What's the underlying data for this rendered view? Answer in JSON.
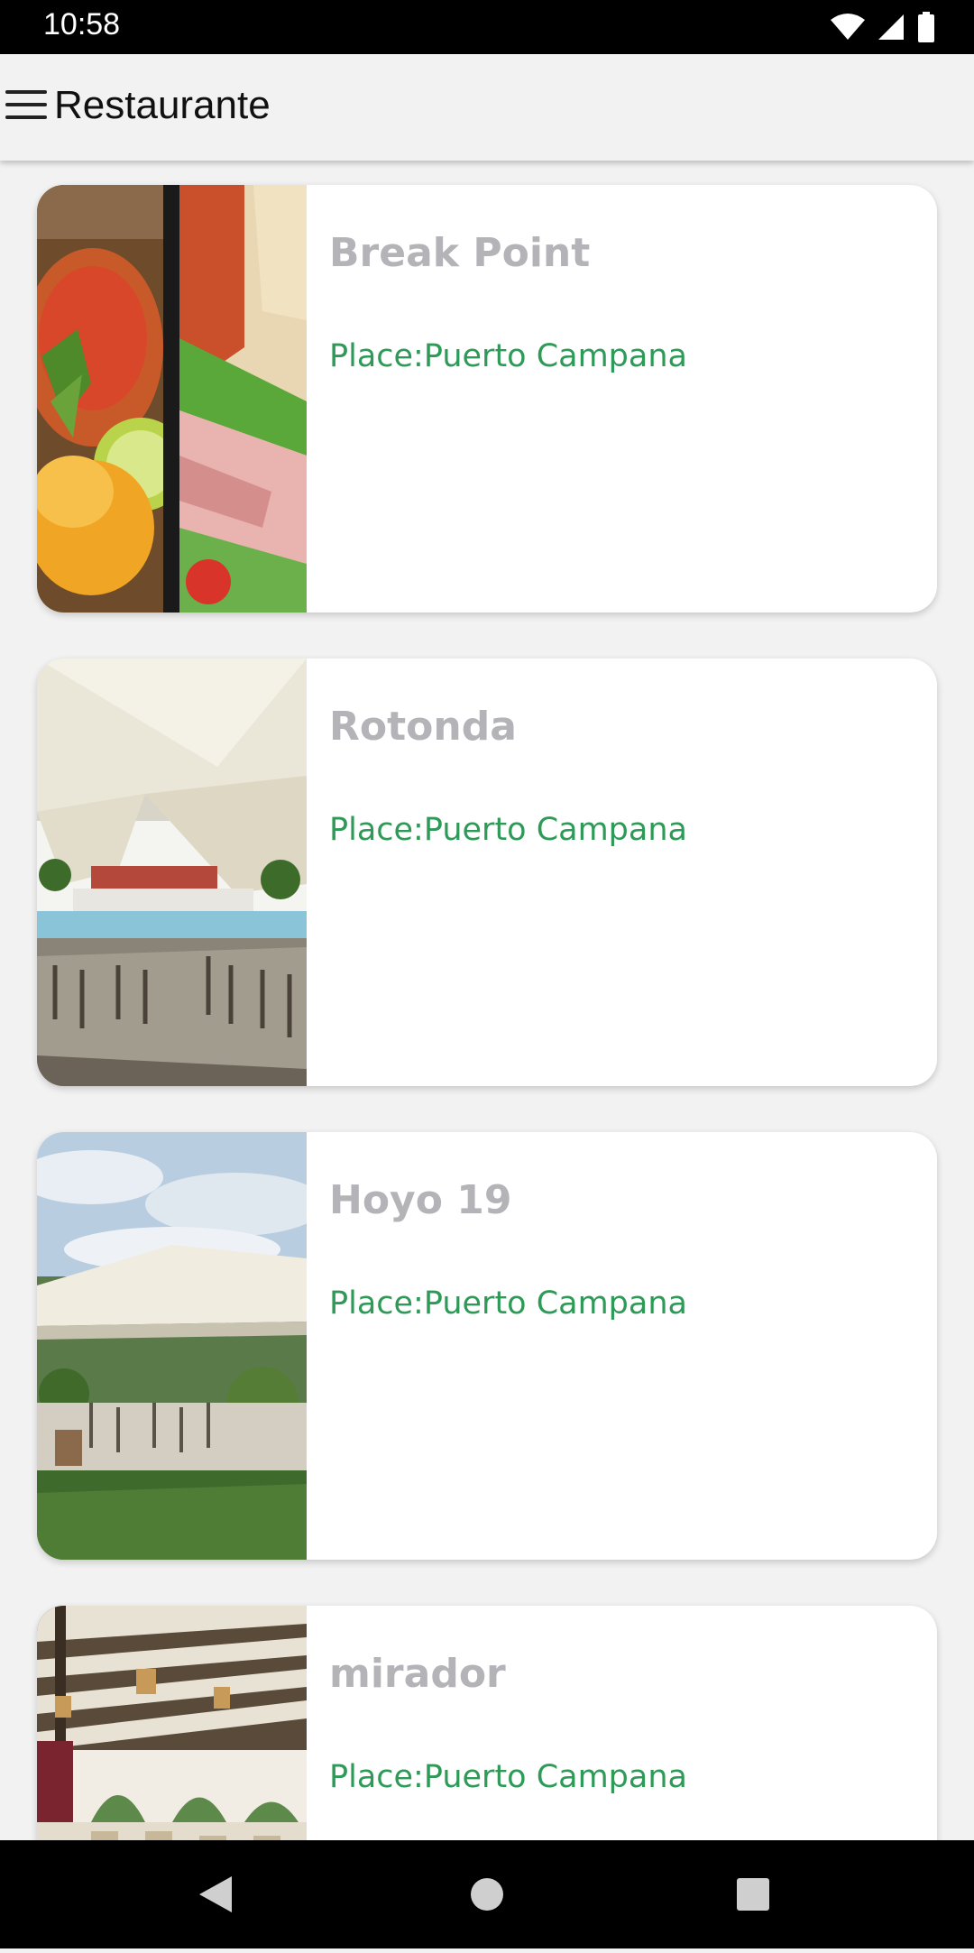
{
  "status_bar": {
    "time": "10:58",
    "icons": [
      "wifi-icon",
      "cellular-icon",
      "battery-icon"
    ]
  },
  "app_bar": {
    "title": "Restaurante",
    "menu_icon": "menu-icon"
  },
  "restaurants": [
    {
      "name": "Break Point",
      "place": "Place:Puerto Campana",
      "image": "salsa-and-sandwich-photo"
    },
    {
      "name": "Rotonda",
      "place": "Place:Puerto Campana",
      "image": "tent-terrace-pool-photo"
    },
    {
      "name": "Hoyo 19",
      "place": "Place:Puerto Campana",
      "image": "tent-terrace-lawn-photo"
    },
    {
      "name": "mirador",
      "place": "Place:Puerto Campana",
      "image": "covered-dining-hall-photo"
    }
  ],
  "nav_bar": {
    "buttons": [
      "back-icon",
      "home-icon",
      "recents-icon"
    ]
  },
  "colors": {
    "place_text": "#2e9a57",
    "name_text": "#b4b4b8",
    "background": "#f2f2f2"
  }
}
